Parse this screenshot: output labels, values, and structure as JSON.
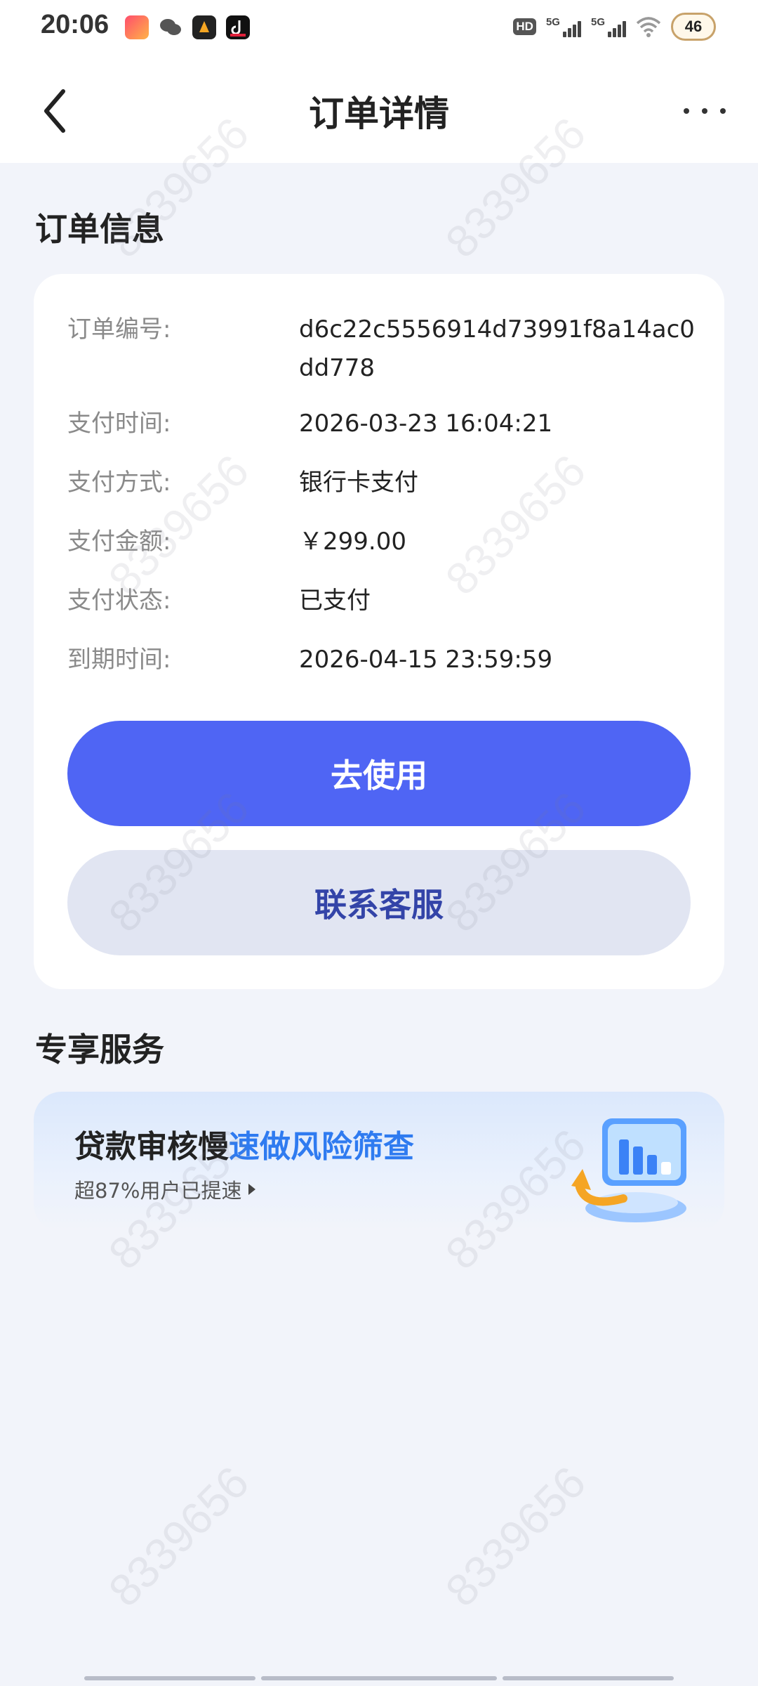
{
  "status_bar": {
    "time": "20:06",
    "app_icons": [
      "meitu-app-icon",
      "wechat-app-icon",
      "game-app-icon",
      "douyin-app-icon"
    ],
    "hd_label": "HD",
    "signal_label_1": "5G",
    "signal_label_2": "5G",
    "battery": "46"
  },
  "nav": {
    "title": "订单详情"
  },
  "order_section": {
    "title": "订单信息",
    "rows": [
      {
        "label": "订单编号:",
        "value": "d6c22c5556914d73991f8a14ac0dd778"
      },
      {
        "label": "支付时间:",
        "value": "2026-03-23 16:04:21"
      },
      {
        "label": "支付方式:",
        "value": "银行卡支付"
      },
      {
        "label": "支付金额:",
        "value": "￥299.00"
      },
      {
        "label": "支付状态:",
        "value": "已支付"
      },
      {
        "label": "到期时间:",
        "value": "2026-04-15 23:59:59"
      }
    ],
    "primary_button": "去使用",
    "secondary_button": "联系客服"
  },
  "service_section": {
    "title": "专享服务",
    "banner_title_plain": "贷款审核慢",
    "banner_title_highlight": "速做风险筛查",
    "banner_subtitle": "超87%用户已提速"
  },
  "watermark": "8339656",
  "colors": {
    "primary": "#4f65f4",
    "secondary_bg": "#e1e5f2",
    "secondary_text": "#3344a8",
    "highlight": "#2f7bf0",
    "page_bg": "#f2f4fa"
  }
}
